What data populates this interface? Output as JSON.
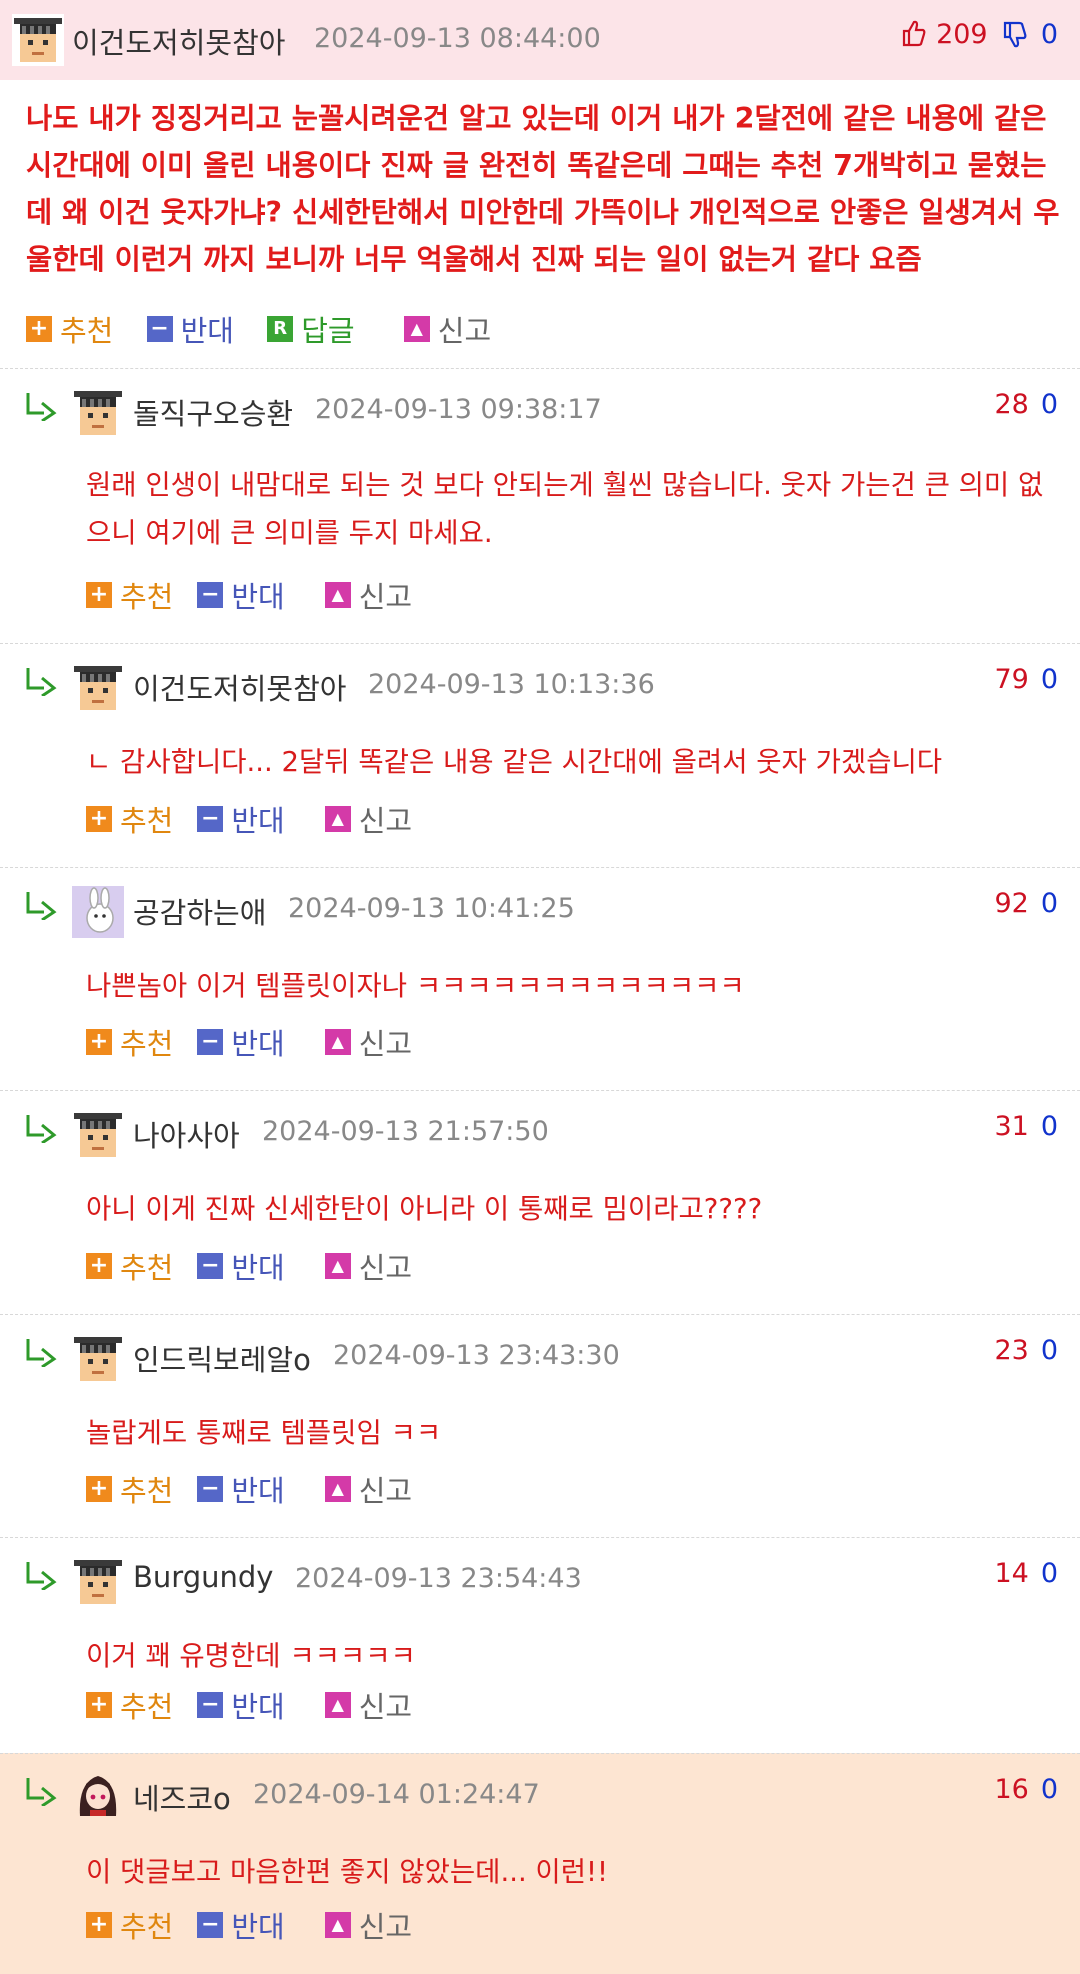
{
  "post": {
    "author": "이건도저히못참아",
    "date": "2024-09-13 08:44:00",
    "up": "209",
    "down": "0",
    "text": "나도 내가 징징거리고 눈꼴시려운건 알고 있는데 이거 내가 2달전에 같은 내용에 같은 시간대에 이미 올린 내용이다 진짜 글 완전히 똑같은데 그때는 추천 7개박히고 묻혔는데 왜 이건 웃자가냐? 신세한탄해서 미안한데 가뜩이나 개인적으로 안좋은 일생겨서 우울한데 이런거 까지 보니까 너무 억울해서 진짜 되는 일이 없는거 같다 요즘",
    "actions": {
      "recommend": "추천",
      "oppose": "반대",
      "reply": "답글",
      "report": "신고"
    }
  },
  "comment_actions": {
    "recommend": "추천",
    "oppose": "반대",
    "report": "신고"
  },
  "comments": [
    {
      "author": "돌직구오승환",
      "date": "2024-09-13 09:38:17",
      "up": "28",
      "down": "0",
      "text": "원래 인생이 내맘대로 되는 것 보다 안되는게 훨씬 많습니다. 웃자 가는건 큰 의미 없으니 여기에 큰 의미를 두지 마세요."
    },
    {
      "author": "이건도저히못참아",
      "date": "2024-09-13 10:13:36",
      "up": "79",
      "down": "0",
      "text": "ㄴ 감사합니다... 2달뒤 똑같은 내용 같은 시간대에 올려서 웃자 가겠습니다"
    },
    {
      "author": "공감하는애",
      "date": "2024-09-13 10:41:25",
      "up": "92",
      "down": "0",
      "text": "나쁜놈아 이거 템플릿이자나 ㅋㅋㅋㅋㅋㅋㅋㅋㅋㅋㅋㅋㅋ"
    },
    {
      "author": "나아사아",
      "date": "2024-09-13 21:57:50",
      "up": "31",
      "down": "0",
      "text": "아니 이게 진짜 신세한탄이 아니라 이 통째로 밈이라고????"
    },
    {
      "author": "인드릭보레알o",
      "date": "2024-09-13 23:43:30",
      "up": "23",
      "down": "0",
      "text": "놀랍게도 통째로 템플릿임 ㅋㅋ"
    },
    {
      "author": "Burgundy",
      "date": "2024-09-13 23:54:43",
      "up": "14",
      "down": "0",
      "text": "이거 꽤 유명한데 ㅋㅋㅋㅋㅋ"
    },
    {
      "author": "네즈코o",
      "date": "2024-09-14 01:24:47",
      "up": "16",
      "down": "0",
      "text": "이 댓글보고 마음한편 좋지 않았는데... 이런!!"
    }
  ],
  "colors": {
    "header_bg": "#fce4e8",
    "highlight_bg": "#fde5d2",
    "text_red": "#e11b1b",
    "up": "#cc1122",
    "down": "#1133cc"
  },
  "icons": {
    "avatar_default": "pixel-avatar-icon",
    "avatar_bunny": "bunny-avatar-icon",
    "avatar_anime": "anime-avatar-icon",
    "thumb_up": "thumb-up-icon",
    "thumb_down": "thumb-down-icon",
    "reply_arrow": "reply-arrow-icon"
  }
}
